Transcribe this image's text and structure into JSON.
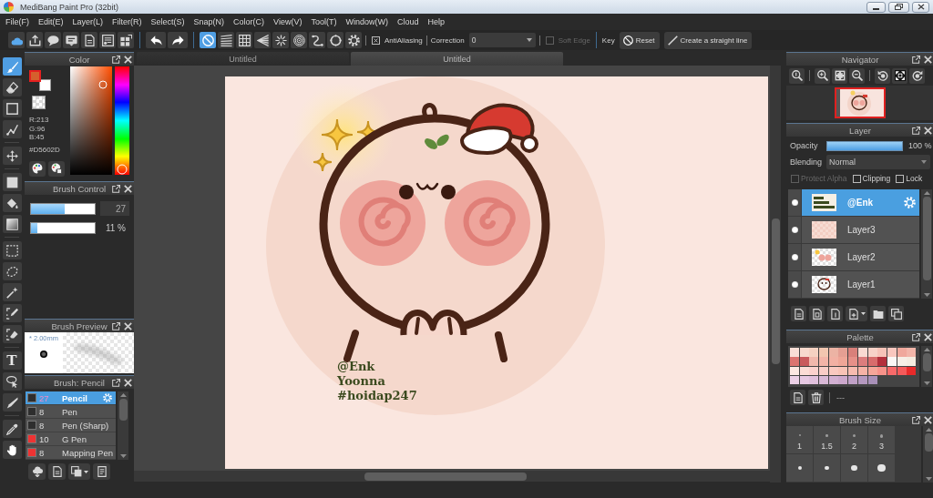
{
  "window": {
    "title": "MediBang Paint Pro (32bit)"
  },
  "menu": [
    "File(F)",
    "Edit(E)",
    "Layer(L)",
    "Filter(R)",
    "Select(S)",
    "Snap(N)",
    "Color(C)",
    "View(V)",
    "Tool(T)",
    "Window(W)",
    "Cloud",
    "Help"
  ],
  "toolbar": {
    "snaps": [
      {
        "selected": true
      },
      {
        "selected": false
      },
      {
        "selected": false
      },
      {
        "selected": false
      },
      {
        "selected": false
      },
      {
        "selected": false
      },
      {
        "selected": false
      },
      {
        "selected": false
      },
      {
        "selected": false
      }
    ],
    "antialiasing": {
      "label": "AntiAliasing",
      "checked": true,
      "disabled": false
    },
    "correction": {
      "label": "Correction",
      "value": "0"
    },
    "soft_edge": {
      "label": "Soft Edge",
      "checked": false,
      "disabled": true
    },
    "key_label": "Key",
    "buttons": [
      "Reset",
      "Create a straight line"
    ]
  },
  "tool_groups": [
    [
      {
        "selected": true
      },
      {
        "selected": false
      },
      {
        "selected": false
      },
      {
        "selected": false
      }
    ],
    [
      {
        "selected": false
      }
    ],
    [
      {
        "selected": false
      },
      {
        "selected": false
      },
      {
        "selected": false
      }
    ],
    [
      {
        "selected": false
      },
      {
        "selected": false
      },
      {
        "selected": false
      },
      {
        "selected": false
      },
      {
        "selected": false
      }
    ],
    [
      {
        "label": "T",
        "selected": false
      },
      {
        "selected": false
      },
      {
        "selected": false
      }
    ],
    [
      {
        "selected": false
      },
      {
        "selected": false
      }
    ]
  ],
  "color": {
    "title": "Color",
    "swatches": [
      {
        "kind": "foreground",
        "color": "#d5602d"
      },
      {
        "kind": "background",
        "color": "#ffffff"
      }
    ],
    "rgb": [
      "R:213",
      "G:96",
      "B:45"
    ],
    "hex": "#D5602D",
    "hue_slider": {
      "level": 0.05
    }
  },
  "brush_control": {
    "title": "Brush Control",
    "sliders": [
      {
        "level": 0.53,
        "value": "27"
      },
      {
        "level": 0.1,
        "reading": "11 %"
      }
    ]
  },
  "brush_preview": {
    "title": "Brush Preview",
    "size": "* 2.00mm"
  },
  "brush_list": {
    "title": "Brush: Pencil",
    "brushes": [
      {
        "color": "#2e2e2e",
        "size": "27",
        "name": "Pencil",
        "selected": true
      },
      {
        "color": "#2e2e2e",
        "size": "8",
        "name": "Pen",
        "selected": false
      },
      {
        "color": "#2e2e2e",
        "size": "8",
        "name": "Pen (Sharp)",
        "selected": false
      },
      {
        "color": "#ee3333",
        "size": "10",
        "name": "G Pen",
        "selected": false
      },
      {
        "color": "#ee3333",
        "size": "8",
        "name": "Mapping Pen",
        "selected": false
      }
    ]
  },
  "tabs": [
    {
      "label": "Untitled",
      "selected": false
    },
    {
      "label": "Untitled",
      "selected": true
    }
  ],
  "canvas": {
    "signature": [
      "@Enk",
      "Yoonna",
      "#hoidap247"
    ]
  },
  "navigator": {
    "title": "Navigator"
  },
  "layer": {
    "title": "Layer",
    "opacity": {
      "label": "Opacity",
      "level": 1,
      "reading": "100 %"
    },
    "blending": {
      "label": "Blending",
      "value": "Normal"
    },
    "options": [
      {
        "label": "Protect Alpha",
        "checked": false,
        "disabled": true
      },
      {
        "label": "Clipping",
        "checked": false,
        "disabled": false
      },
      {
        "label": "Lock",
        "checked": false,
        "disabled": false
      }
    ],
    "layers": [
      {
        "name": "@Enk",
        "selected": true,
        "visible": true
      },
      {
        "name": "Layer3",
        "selected": false,
        "visible": true
      },
      {
        "name": "Layer2",
        "selected": false,
        "visible": true
      },
      {
        "name": "Layer1",
        "selected": false,
        "visible": true
      }
    ]
  },
  "palette": {
    "title": "Palette",
    "swatches": [
      {
        "color": "#f9ded6"
      },
      {
        "color": "#f8d9cd"
      },
      {
        "color": "#f5d2c2"
      },
      {
        "color": "#f2c6b0"
      },
      {
        "color": "#ecb3a4"
      },
      {
        "color": "#e59f93"
      },
      {
        "color": "#d9807a"
      },
      {
        "color": "#f9dad2"
      },
      {
        "color": "#f8d2c8"
      },
      {
        "color": "#f6c3b8"
      },
      {
        "color": "#f9c7be"
      },
      {
        "color": "#f0a89c"
      },
      {
        "color": "#f2b5a9"
      },
      {
        "color": "#dc7470"
      },
      {
        "color": "#c95a5c"
      },
      {
        "color": "#f1b8ac"
      },
      {
        "color": "#f3b4a8"
      },
      {
        "color": "#f2b0a3"
      },
      {
        "color": "#efa697"
      },
      {
        "color": "#e69088"
      },
      {
        "color": "#dc7d7d"
      },
      {
        "color": "#d86c6c"
      },
      {
        "color": "#b3303c"
      },
      {
        "color": "#fbf8f5"
      },
      {
        "color": "#f7efe6"
      },
      {
        "color": "#f4ece0"
      },
      {
        "color": "#fde8e2"
      },
      {
        "color": "#fbdcd5"
      },
      {
        "color": "#fbd2cd"
      },
      {
        "color": "#f9cdc7"
      },
      {
        "color": "#f9c9c0"
      },
      {
        "color": "#f8c3b6"
      },
      {
        "color": "#f7bbaf"
      },
      {
        "color": "#f6b3a6"
      },
      {
        "color": "#f5a699"
      },
      {
        "color": "#f7928a"
      },
      {
        "color": "#f86a6a"
      },
      {
        "color": "#f45a5a"
      },
      {
        "color": "#e82a2a"
      },
      {
        "color": "#ecd0e6"
      },
      {
        "color": "#e6c8e2"
      },
      {
        "color": "#e0c0dc"
      },
      {
        "color": "#d8b8d6"
      },
      {
        "color": "#d2b0d2"
      },
      {
        "color": "#cca8cc"
      },
      {
        "color": "#c0a0c6"
      },
      {
        "color": "#b498bf"
      },
      {
        "color": "#a890b8"
      }
    ],
    "label": "---"
  },
  "brush_size": {
    "title": "Brush Size",
    "presets": [
      {
        "kind": "labeled",
        "label": "1"
      },
      {
        "kind": "labeled",
        "label": "1.5"
      },
      {
        "kind": "labeled",
        "label": "2"
      },
      {
        "kind": "labeled",
        "label": "3"
      },
      {
        "kind": "dot"
      },
      {
        "kind": "dot"
      },
      {
        "kind": "dot"
      },
      {
        "kind": "dot"
      }
    ]
  }
}
